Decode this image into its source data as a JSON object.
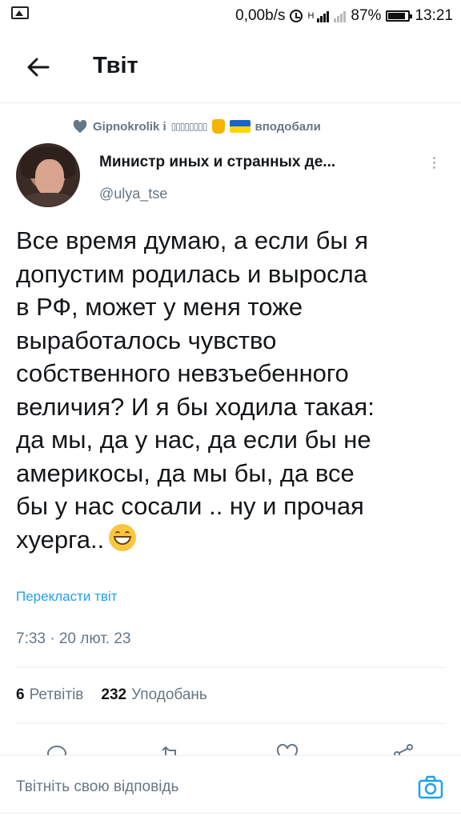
{
  "status_bar": {
    "speed": "0,00b/s",
    "network": "H",
    "battery": "87%",
    "battery_level": 0.87,
    "time": "13:21"
  },
  "header": {
    "title": "Твіт"
  },
  "context": {
    "text": "Gipnokrolik і",
    "boxes": "▯▯▯▯▯▯▯▯",
    "suffix": "вподобали"
  },
  "author": {
    "name": "Министр иных и странных де...",
    "handle": "@ulya_tse"
  },
  "tweet": {
    "lines": [
      "Все время думаю, а если бы я",
      "допустим родилась и выросла",
      "в РФ, может у меня тоже",
      "выработалось чувство",
      "собственного невзъебенного",
      "величия? И я бы ходила такая:",
      "да мы, да у нас, да если бы не",
      "америкосы, да мы бы, да все",
      "бы у нас сосали .. ну и прочая",
      "хуерга.."
    ],
    "translate": "Перекласти твіт",
    "timestamp": "7:33 · 20 лют. 23"
  },
  "stats": {
    "retweets_count": "6",
    "retweets_label": "Ретвітів",
    "likes_count": "232",
    "likes_label": "Уподобань"
  },
  "reply": {
    "placeholder": "Твітніть свою відповідь"
  },
  "colors": {
    "accent": "#1da1f2",
    "secondary_text": "#657786",
    "divider": "#e6ecf0"
  }
}
